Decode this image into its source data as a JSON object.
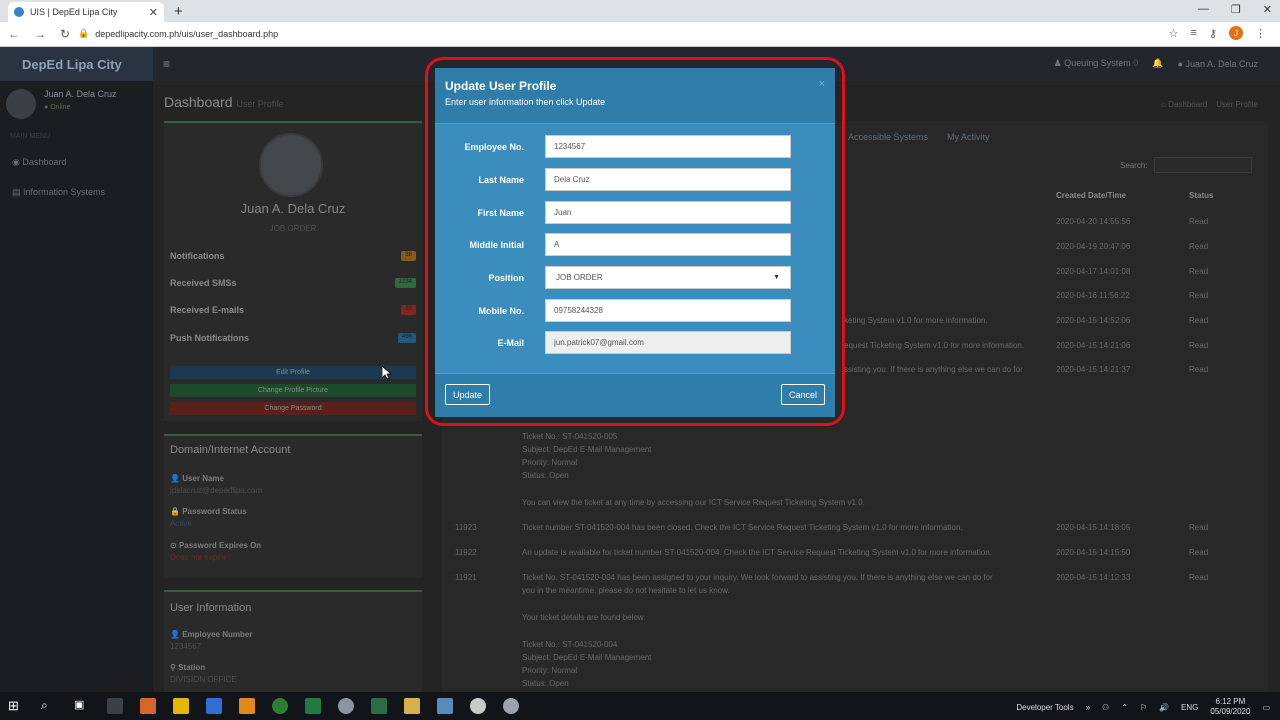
{
  "browser": {
    "tab_title": "UIS | DepEd Lipa City",
    "url": "depedlipacity.com.ph/uis/user_dashboard.php",
    "profile_initial": "J"
  },
  "app": {
    "brand": "DepEd Lipa City",
    "queuing": "Queuing System",
    "queuing_count": "0",
    "user_name": "Juan A. Dela Cruz"
  },
  "sidebar": {
    "name": "Juan A. Dela Cruz",
    "status": "Online",
    "section": "MAIN MENU",
    "items": [
      "Dashboard",
      "Information Systems"
    ]
  },
  "header": {
    "title": "Dashboard",
    "subtitle": "User Profile",
    "breadcrumb": [
      "Dashboard",
      "User Profile"
    ]
  },
  "profile": {
    "name": "Juan A. Dela Cruz",
    "position": "JOB ORDER",
    "stats": [
      {
        "label": "Notifications",
        "value": "38",
        "color": "#8a5a1c"
      },
      {
        "label": "Received SMSs",
        "value": "1234",
        "color": "#2e6a3a"
      },
      {
        "label": "Received E-mails",
        "value": "38",
        "color": "#7a2a22"
      },
      {
        "label": "Push Notifications",
        "value": "456",
        "color": "#1f5a7a"
      }
    ],
    "buttons": [
      "Edit Profile",
      "Change Profile Picture",
      "Change Password"
    ]
  },
  "account": {
    "title": "Domain/Internet Account",
    "username_label": "User Name",
    "username": "jdelacruz@depedlipa.com",
    "pwstatus_label": "Password Status",
    "pwstatus": "Active",
    "pwexpire_label": "Password Expires On",
    "pwexpire": "Does not expire"
  },
  "userinfo": {
    "title": "User Information",
    "empno_label": "Employee Number",
    "empno": "1234567",
    "station_label": "Station",
    "station": "DIVISION OFFICE"
  },
  "activity": {
    "tabs": [
      "Accessible Systems",
      "My Activity"
    ],
    "search_label": "Search:",
    "columns": [
      "Created Date/Time",
      "Status"
    ],
    "rows_right": [
      {
        "date": "2020-04-20 14:55:56",
        "status": "Read"
      },
      {
        "date": "2020-04-19 20:47:06",
        "status": "Read"
      },
      {
        "date": "2020-04-17 14:01:08",
        "status": "Read"
      },
      {
        "date": "2020-04-16 11:56:22",
        "status": "Read"
      },
      {
        "date": "2020-04-15 14:52:06",
        "status": "Read"
      },
      {
        "date": "2020-04-15 14:21:06",
        "status": "Read"
      },
      {
        "date": "2020-04-15 14:21:37",
        "status": "Read"
      }
    ],
    "partial_msgs": [
      "keting System v1.0 for more information.",
      "equest Ticketing System v1.0 for more information.",
      "ssisting you. If there is anything else we can do for"
    ],
    "ticket_block": [
      "Ticket No.: ST-041520-005",
      "Subject: DepEd E-Mail Management",
      "Priority: Normal",
      "Status: Open"
    ],
    "view_text": "You can view the ticket at any time by accessing our ICT Service Request Ticketing System v1.0.",
    "rows": [
      {
        "id": "11923",
        "msg": "Ticket number ST-041520-004 has been closed. Check the ICT Service Request Ticketing System v1.0 for more information.",
        "date": "2020-04-15 14:18:05",
        "status": "Read"
      },
      {
        "id": "11922",
        "msg": "An update is available for ticket number ST-041520-004. Check the ICT Service Request Ticketing System v1.0 for more information.",
        "date": "2020-04-15 14:15:50",
        "status": "Read"
      },
      {
        "id": "11921",
        "msg": "Ticket No. ST-041520-004 has been assigned to your inquiry. We look forward to assisting you. If there is anything else we can do for",
        "date": "2020-04-15 14:12:33",
        "status": "Read"
      }
    ],
    "msg_cont": "you in the meantime, please do not hesitate to let us know.",
    "details_text": "Your ticket details are found below.",
    "ticket_block2": [
      "Ticket No.: ST-041520-004",
      "Subject: DepEd E-Mail Management",
      "Priority: Normal",
      "Status: Open"
    ]
  },
  "modal": {
    "title": "Update User Profile",
    "subtitle": "Enter user information then click Update",
    "fields": {
      "employee_no": {
        "label": "Employee No.",
        "value": "1234567"
      },
      "last_name": {
        "label": "Last Name",
        "value": "Dela Cruz"
      },
      "first_name": {
        "label": "First Name",
        "value": "Juan"
      },
      "middle_initial": {
        "label": "Middle Initial",
        "value": "A"
      },
      "position": {
        "label": "Position",
        "value": "JOB ORDER"
      },
      "mobile_no": {
        "label": "Mobile No.",
        "value": "09758244328"
      },
      "email": {
        "label": "E-Mail",
        "value": "jun.patrick07@gmail.com"
      }
    },
    "update_label": "Update",
    "cancel_label": "Cancel",
    "highlight_color": "#e0101b"
  },
  "taskbar": {
    "devtools": "Developer Tools",
    "lang": "ENG",
    "time": "6:12 PM",
    "date": "05/09/2020"
  }
}
